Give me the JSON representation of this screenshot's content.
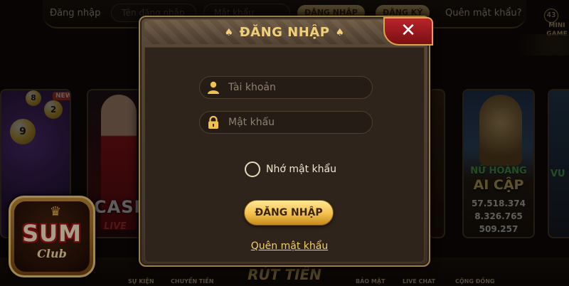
{
  "background": {
    "topbar": {
      "login_label": "Đăng nhập",
      "username_placeholder": "Tên đăng nhập",
      "password_placeholder": "Mật khẩu",
      "login_button": "ĐĂNG NHẬP",
      "register_button": "ĐĂNG KÝ",
      "forgot_link": "Quên mật khẩu?",
      "notification_count": "43",
      "side_label": "MINI GAME"
    },
    "games": {
      "balls_badge": "NEW",
      "casino_title": "CASINO",
      "casino_sub": "LIVE",
      "queen_title": "NỮ HOÀNG",
      "queen_sub": "AI CẬP",
      "queen_jackpots": [
        "57.518.374",
        "8.326.765",
        "509.257"
      ],
      "right_title": "VU"
    },
    "bottom_bar": {
      "items": [
        "SỰ KIỆN",
        "CHUYỂN TIỀN",
        "BẢO MẬT",
        "LIVE CHAT",
        "CỘNG ĐỒNG"
      ],
      "center": "RÚT TIỀN"
    },
    "logo": {
      "brand": "SUM",
      "sub": "Club"
    }
  },
  "modal": {
    "title": "ĐĂNG NHẬP",
    "title_ornament": "♠",
    "close_symbol": "✕",
    "username": {
      "placeholder": "Tài khoản",
      "value": "",
      "icon": "user-icon"
    },
    "password": {
      "placeholder": "Mật khẩu",
      "value": "",
      "icon": "lock-icon"
    },
    "remember_label": "Nhớ mật khẩu",
    "remember_checked": false,
    "login_button": "ĐĂNG NHẬP",
    "forgot_link": "Quên mật khẩu"
  },
  "colors": {
    "accent_gold": "#f2cf7a",
    "close_red": "#b8242a",
    "panel_dark": "#2f241b"
  }
}
